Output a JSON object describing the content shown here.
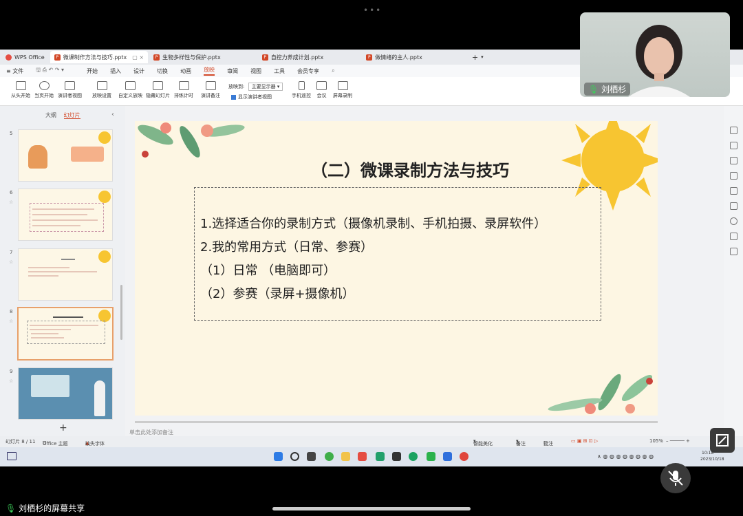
{
  "tabs": [
    {
      "label": "WPS Office",
      "type": "wps"
    },
    {
      "label": "微课制作方法与技巧.pptx",
      "type": "ppt",
      "active": true
    },
    {
      "label": "生物多样性与保护.pptx",
      "type": "ppt"
    },
    {
      "label": "自控力养成计划.pptx",
      "type": "ppt"
    },
    {
      "label": "做情绪的主人.pptx",
      "type": "ppt"
    }
  ],
  "menu": {
    "file": "≡ 文件",
    "items": [
      "开始",
      "插入",
      "设计",
      "切换",
      "动画",
      "放映",
      "审阅",
      "视图",
      "工具",
      "会员专享"
    ]
  },
  "ribbon": {
    "from_start": "从头开始",
    "from_current": "当页开始",
    "presenter_view": "演讲者视图",
    "show_settings": "放映设置",
    "custom_show": "自定义放映",
    "hide_slide": "隐藏幻灯片",
    "rehearse": "排练计时",
    "speaker_notes": "演讲备注",
    "show_on_label": "放映到",
    "show_on_value": "主要显示器",
    "show_presenter_view": "显示演讲者视图",
    "phone_remote": "手机遥控",
    "meeting": "会议",
    "screen_record": "屏幕录制"
  },
  "panel": {
    "outline": "大纲",
    "slides": "幻灯片",
    "numbers": [
      "5",
      "6",
      "7",
      "8",
      "9"
    ]
  },
  "slide": {
    "title": "（二）微课录制方法与技巧",
    "lines": [
      "1.选择适合你的录制方式（摄像机录制、手机拍摄、录屏软件）",
      "2.我的常用方式（日常、参赛）",
      "（1）日常 （电脑即可）",
      "（2）参赛（录屏+摄像机）"
    ]
  },
  "notes_placeholder": "单击此处添加备注",
  "status": {
    "slide_count": "幻灯片 8 / 11",
    "theme": "Office 主题",
    "missing_font": "缺失字体",
    "smart_beautify": "智能美化",
    "notes": "备注",
    "comments": "批注",
    "zoom": "105%"
  },
  "clock": {
    "time": "10:18",
    "date": "2023/10/18"
  },
  "video": {
    "name": "刘栖杉"
  },
  "share_label": "刘栖杉的屏幕共享",
  "colors": {
    "accent": "#d24726",
    "slide_bg": "#fdf6e3",
    "sun": "#f7c531"
  }
}
